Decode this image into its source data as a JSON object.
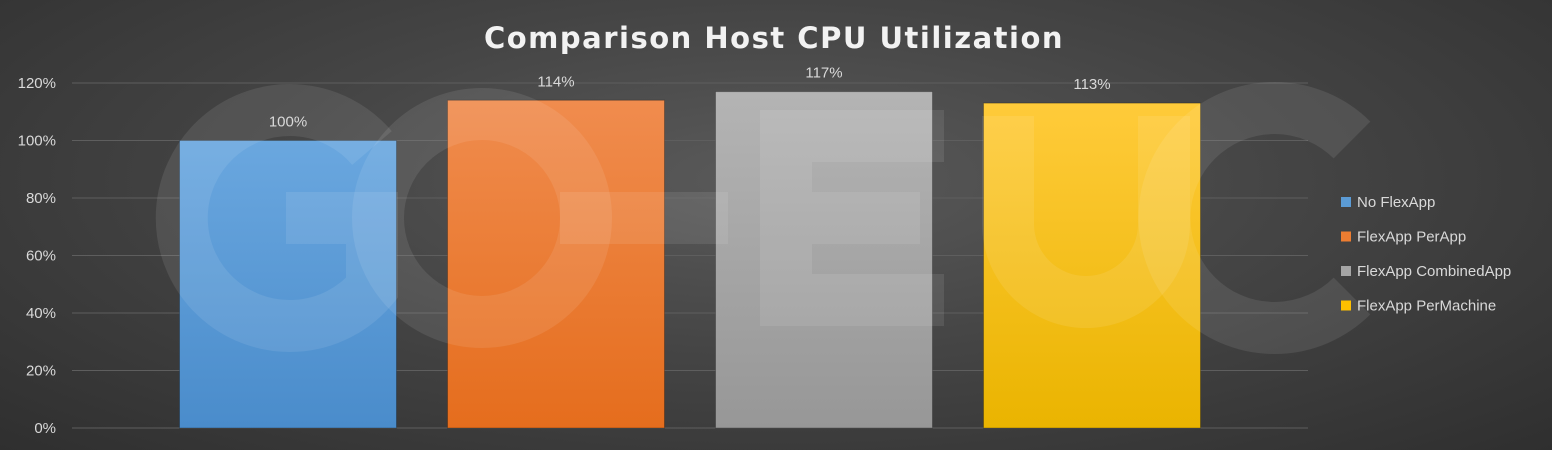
{
  "chart_data": {
    "type": "bar",
    "title": "Comparison Host CPU Utilization",
    "xlabel": "",
    "ylabel": "",
    "ylim": [
      0,
      120
    ],
    "yticks": [
      0,
      20,
      40,
      60,
      80,
      100,
      120
    ],
    "ytick_labels": [
      "0%",
      "20%",
      "40%",
      "60%",
      "80%",
      "100%",
      "120%"
    ],
    "grid": true,
    "legend_position": "right",
    "series": [
      {
        "name": "No FlexApp",
        "value": 100,
        "label": "100%",
        "color": "#5b9bd5"
      },
      {
        "name": "FlexApp PerApp",
        "value": 114,
        "label": "114%",
        "color": "#ed7d31"
      },
      {
        "name": "FlexApp CombinedApp",
        "value": 117,
        "label": "117%",
        "color": "#a5a5a5"
      },
      {
        "name": "FlexApp PerMachine",
        "value": 113,
        "label": "113%",
        "color": "#ffc000"
      }
    ],
    "watermark": "GO-EUC"
  }
}
